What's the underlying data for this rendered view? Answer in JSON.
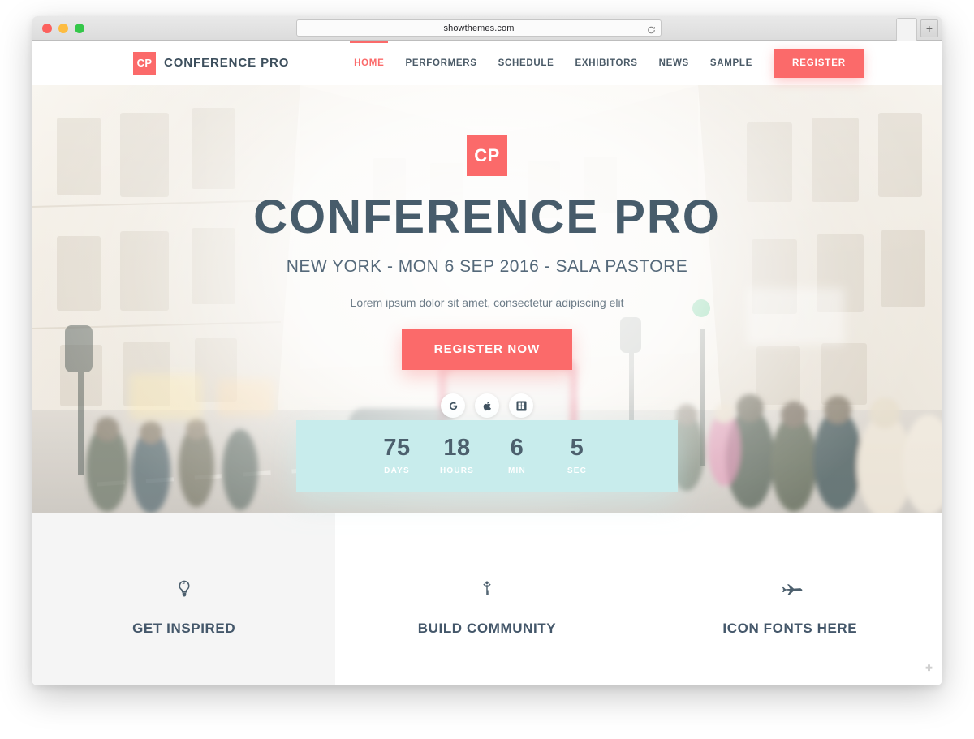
{
  "browser": {
    "url": "showthemes.com",
    "reload_icon": "reload-icon",
    "new_tab_label": "+",
    "traffic_lights": [
      "close-red",
      "minimize-yellow",
      "maximize-green"
    ]
  },
  "site": {
    "brand": {
      "mark": "CP",
      "name": "CONFERENCE PRO"
    },
    "nav": [
      {
        "label": "HOME",
        "active": true
      },
      {
        "label": "PERFORMERS",
        "active": false
      },
      {
        "label": "SCHEDULE",
        "active": false
      },
      {
        "label": "EXHIBITORS",
        "active": false
      },
      {
        "label": "NEWS",
        "active": false
      },
      {
        "label": "SAMPLE",
        "active": false
      }
    ],
    "nav_cta": "REGISTER"
  },
  "hero": {
    "mark": "CP",
    "title": "CONFERENCE PRO",
    "subtitle": "NEW YORK - MON 6 SEP 2016 - SALA PASTORE",
    "tagline": "Lorem ipsum dolor sit amet, consectetur adipiscing elit",
    "cta": "REGISTER NOW",
    "app_badges": [
      {
        "name": "google-icon",
        "glyph": "G"
      },
      {
        "name": "apple-icon",
        "glyph": "apple"
      },
      {
        "name": "windows-icon",
        "glyph": "windows"
      }
    ]
  },
  "countdown": [
    {
      "value": "75",
      "label": "DAYS"
    },
    {
      "value": "18",
      "label": "HOURS"
    },
    {
      "value": "6",
      "label": "MIN"
    },
    {
      "value": "5",
      "label": "SEC"
    }
  ],
  "features": [
    {
      "label": "GET INSPIRED",
      "icon": "lightbulb-icon"
    },
    {
      "label": "BUILD COMMUNITY",
      "icon": "person-raising-arms-icon"
    },
    {
      "label": "ICON FONTS HERE",
      "icon": "airplane-icon"
    }
  ],
  "colors": {
    "accent": "#fb6a6a",
    "ink": "#44576a",
    "countdown_bg": "#c8ecec",
    "shaded_panel": "#f5f5f5"
  }
}
